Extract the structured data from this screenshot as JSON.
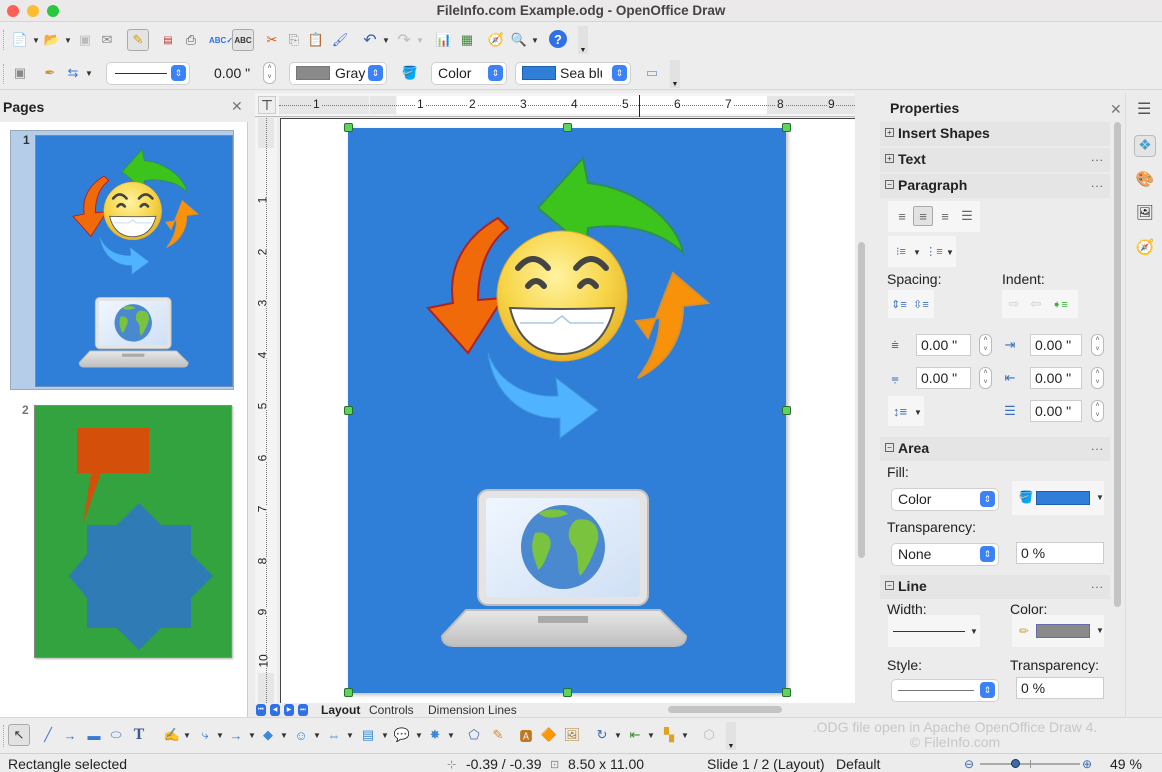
{
  "window": {
    "title": "FileInfo.com Example.odg - OpenOffice Draw",
    "traffic_lights": [
      {
        "name": "close",
        "color": "#fe5f57"
      },
      {
        "name": "minimize",
        "color": "#febc2e"
      },
      {
        "name": "zoom",
        "color": "#28c840"
      }
    ]
  },
  "toolbar_standard": {
    "icons": [
      "new-document-icon",
      "open-folder-icon",
      "save-icon",
      "email-icon",
      "edit-file-icon",
      "export-pdf-icon",
      "print-icon",
      "spellcheck-icon",
      "autospellcheck-icon",
      "cut-icon",
      "copy-icon",
      "paste-icon",
      "clone-formatting-icon",
      "undo-icon",
      "redo-icon",
      "chart-icon",
      "spreadsheet-icon",
      "navigator-icon",
      "zoom-icon",
      "help-icon"
    ]
  },
  "toolbar_line_fill": {
    "line_width": "0.00 \"",
    "line_color_label": "Gray",
    "area_style": "Color",
    "area_color_label": "Sea blue",
    "line_color": "#8a8a8a",
    "area_color": "#2f7fd8"
  },
  "pages_panel": {
    "title": "Pages",
    "pages": [
      {
        "number": "1",
        "selected": true
      },
      {
        "number": "2",
        "selected": false
      }
    ]
  },
  "ruler": {
    "h_ticks": [
      "1",
      "1",
      "2",
      "3",
      "4",
      "5",
      "6",
      "7",
      "8",
      "9"
    ],
    "v_ticks": [
      "1",
      "2",
      "3",
      "4",
      "5",
      "6",
      "7",
      "8",
      "9",
      "10"
    ]
  },
  "tabs": {
    "items": [
      {
        "label": "Layout",
        "active": true
      },
      {
        "label": "Controls",
        "active": false
      },
      {
        "label": "Dimension Lines",
        "active": false
      }
    ]
  },
  "properties": {
    "title": "Properties",
    "sections": {
      "insert_shapes": "Insert Shapes",
      "text": "Text",
      "paragraph": "Paragraph",
      "area": "Area",
      "line": "Line"
    },
    "paragraph": {
      "spacing_label": "Spacing:",
      "indent_label": "Indent:",
      "above_spacing": "0.00 \"",
      "below_spacing": "0.00 \"",
      "before_indent": "0.00 \"",
      "after_indent": "0.00 \"",
      "first_line_indent": "0.00 \""
    },
    "area": {
      "fill_label": "Fill:",
      "fill_value": "Color",
      "fill_color": "#2f7fd8",
      "transparency_label": "Transparency:",
      "transparency_mode": "None",
      "transparency_value": "0 %"
    },
    "line": {
      "width_label": "Width:",
      "color_label": "Color:",
      "color": "#8a8a8a",
      "style_label": "Style:",
      "transparency_label": "Transparency:",
      "transparency_value": "0 %"
    }
  },
  "status": {
    "selection": "Rectangle selected",
    "position": "-0.39 / -0.39",
    "size": "8.50 x 11.00",
    "slide": "Slide 1 / 2 (Layout)",
    "master": "Default",
    "zoom": "49 %",
    "zoom_fraction": 0.35
  },
  "watermark": {
    "line1": ".ODG file open in Apache OpenOffice Draw 4.",
    "line2": "© FileInfo.com"
  }
}
